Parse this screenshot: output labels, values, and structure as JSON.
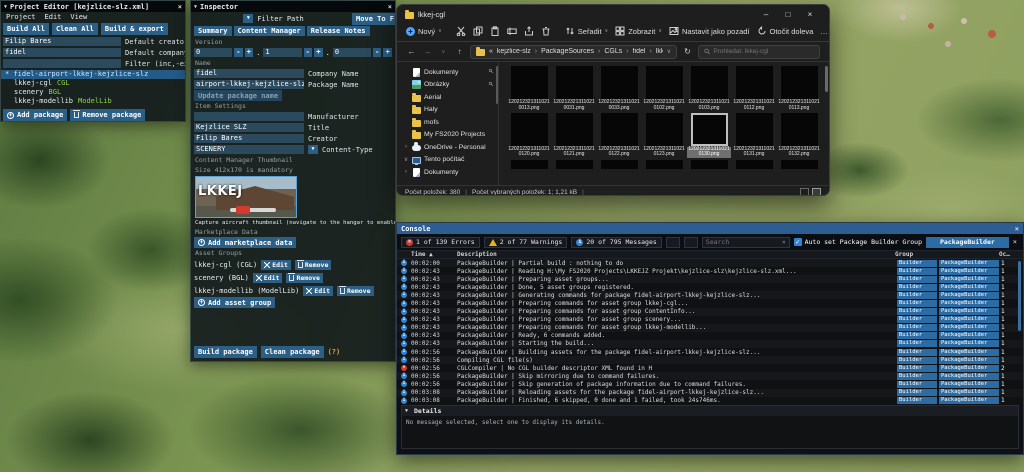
{
  "colors": {
    "accent_blue": "#2d6ca3",
    "sdk_button": "#2c5f86",
    "type_green": "#8ed14f",
    "console_title": "#2d5d91",
    "error_red": "#d23b2e",
    "warning_yellow": "#e7b416",
    "info_blue": "#2f86d6",
    "help_orange": "#e8a13c",
    "folder_yellow": "#e8c24a"
  },
  "icons": {
    "close": "×",
    "minimize": "–",
    "maximize": "□",
    "collapse": "▼",
    "back": "←",
    "forward": "→",
    "up": "↑",
    "refresh": "↻",
    "dropdown": "∨",
    "sort_asc": "▲",
    "check": "✓",
    "more": "…"
  },
  "project_editor": {
    "title": "Project Editor [kejzlice-slz.xml]",
    "menu": [
      "Project",
      "Edit",
      "View"
    ],
    "toolbar": [
      "Build All",
      "Clean All",
      "Build & export"
    ],
    "fields": [
      {
        "value": "Filip Bares",
        "label": "Default creator name"
      },
      {
        "value": "fidel",
        "label": "Default company name"
      },
      {
        "value": "",
        "label": "Filter (inc,-exc)"
      }
    ],
    "tree": {
      "root_prefix": "*",
      "root": "fidel-airport-lkkej-kejzlice-slz",
      "children": [
        {
          "name": "lkkej-cgl",
          "type": "CGL"
        },
        {
          "name": "scenery",
          "type": "BGL"
        },
        {
          "name": "lkkej-modellib",
          "type": "ModelLib"
        }
      ]
    },
    "add_package": "Add package",
    "remove_package": "Remove package"
  },
  "inspector": {
    "title": "Inspector",
    "filter_path": "Filter Path",
    "move_to": "Move To F",
    "tabs": [
      "Summary",
      "Content Manager",
      "Release Notes"
    ],
    "version": {
      "label": "Version",
      "major": "0",
      "minor": "1",
      "patch": "0",
      "minus": "-",
      "plus": "+",
      "dot": "."
    },
    "name_label": "Name",
    "name_fields": [
      {
        "value": "fidel",
        "label": "Company Name"
      },
      {
        "value": "airport-lkkej-kejzlice-slz",
        "label": "Package Name"
      }
    ],
    "update_button": "Update package name",
    "item_label": "Item Settings",
    "item_fields": [
      {
        "value": "",
        "label": "Manufacturer"
      },
      {
        "value": "Kejzlice SLZ",
        "label": "Title"
      },
      {
        "value": "Filip Bares",
        "label": "Creator"
      },
      {
        "value": "SCENERY",
        "label": "Content-Type",
        "kind": "dropdown"
      }
    ],
    "thumb_label": "Content Manager Thumbnail",
    "thumb_note": "Size 412x170 is mandatory",
    "thumb_overlay": "LKKEJ",
    "capture_note": "Capture aircraft thumbnail (navigate to the hangar to enable)",
    "marketplace_label": "Marketplace Data",
    "add_marketplace": "Add marketplace data",
    "asset_groups_label": "Asset Groups",
    "asset_groups": [
      {
        "label": "lkkej-cgl (CGL)"
      },
      {
        "label": "scenery (BGL)"
      },
      {
        "label": "lkkej-modellib (ModelLib)"
      }
    ],
    "edit_label": "Edit",
    "remove_label": "Remove",
    "add_asset_group": "Add asset group",
    "build_package": "Build package",
    "clean_package": "Clean package",
    "help": "(?)"
  },
  "explorer": {
    "title": "lkkej-cgl",
    "toolbar": {
      "new": "Nový",
      "sort": "Seřadit",
      "view": "Zobrazit",
      "wallpaper": "Nastavit jako pozadí",
      "rotate": "Otočit doleva",
      "more": "…"
    },
    "breadcrumb": {
      "prefix": "«",
      "items": [
        "kejzlice-slz",
        "PackageSources",
        "CGLs",
        "fidel",
        "lkkej-cgl"
      ]
    },
    "search_placeholder": "Prohledat: lkkej-cgl",
    "sidebar": [
      {
        "label": "Dokumenty",
        "icon": "doc",
        "pin": "1",
        "chev": ""
      },
      {
        "label": "Obrázky",
        "icon": "pics",
        "pin": "1",
        "chev": ""
      },
      {
        "label": "Aerial",
        "icon": "folder",
        "chev": ""
      },
      {
        "label": "Haly",
        "icon": "folder",
        "chev": ""
      },
      {
        "label": "mofs",
        "icon": "folder",
        "chev": ""
      },
      {
        "label": "My FS2020 Projects",
        "icon": "folder",
        "chev": ""
      },
      {
        "label": "OneDrive - Personal",
        "icon": "cloud",
        "chev": "›"
      },
      {
        "label": "Tento počítač",
        "icon": "pc",
        "chev": "∨"
      },
      {
        "label": "Dokumenty",
        "icon": "doc",
        "chev": "›"
      }
    ],
    "files": {
      "prefix": "120212321311021",
      "items": [
        {
          "name": "0013.png"
        },
        {
          "name": "0031.png"
        },
        {
          "name": "0033.png"
        },
        {
          "name": "0102.png"
        },
        {
          "name": "0103.png"
        },
        {
          "name": "0112.png"
        },
        {
          "name": "0113.png"
        },
        {
          "name": "0120.png"
        },
        {
          "name": "0121.png"
        },
        {
          "name": "0122.png"
        },
        {
          "name": "0123.png"
        },
        {
          "name": "0130.png",
          "sel": "selected"
        },
        {
          "name": "0131.png"
        },
        {
          "name": "0132.png"
        }
      ]
    },
    "status": {
      "items": "Počet položek: 380",
      "selected": "Počet vybraných položek: 1; 1,21 kB"
    }
  },
  "console": {
    "title": "Console",
    "errors": "1 of 139 Errors",
    "warnings": "2 of 77 Warnings",
    "messages": "20 of 795 Messages",
    "search_placeholder": "Search",
    "autoset": "Auto set Package Builder Group",
    "builder_chip": "PackageBuilder",
    "columns": {
      "time": "Time",
      "description": "Description",
      "group": "Group",
      "oc": "Oc…"
    },
    "rows": [
      {
        "lv": "info",
        "t": "00:02:00",
        "d": "PackageBuilder | Partial build : nothing to do",
        "group": "Builder",
        "src": "PackageBuilder",
        "c": "1"
      },
      {
        "lv": "info",
        "t": "00:02:43",
        "d": "PackageBuilder | Reading H:\\My FS2020 Projects\\LKKEJZ Projekt\\kejzlice-slz\\kejzlice-slz.xml...",
        "group": "Builder",
        "src": "PackageBuilder",
        "c": "1"
      },
      {
        "lv": "info",
        "t": "00:02:43",
        "d": "PackageBuilder | Preparing asset groups...",
        "group": "Builder",
        "src": "PackageBuilder",
        "c": "1"
      },
      {
        "lv": "info",
        "t": "00:02:43",
        "d": "PackageBuilder | Done, 5 asset groups registered.",
        "group": "Builder",
        "src": "PackageBuilder",
        "c": "1"
      },
      {
        "lv": "info",
        "t": "00:02:43",
        "d": "PackageBuilder | Generating commands for package fidel-airport-lkkej-kejzlice-slz...",
        "group": "Builder",
        "src": "PackageBuilder",
        "c": "1"
      },
      {
        "lv": "info",
        "t": "00:02:43",
        "d": "PackageBuilder | Preparing commands for asset group lkkej-cgl...",
        "group": "Builder",
        "src": "PackageBuilder",
        "c": "1"
      },
      {
        "lv": "info",
        "t": "00:02:43",
        "d": "PackageBuilder | Preparing commands for asset group ContentInfo...",
        "group": "Builder",
        "src": "PackageBuilder",
        "c": "1"
      },
      {
        "lv": "info",
        "t": "00:02:43",
        "d": "PackageBuilder | Preparing commands for asset group scenery...",
        "group": "Builder",
        "src": "PackageBuilder",
        "c": "1"
      },
      {
        "lv": "info",
        "t": "00:02:43",
        "d": "PackageBuilder | Preparing commands for asset group lkkej-modellib...",
        "group": "Builder",
        "src": "PackageBuilder",
        "c": "1"
      },
      {
        "lv": "info",
        "t": "00:02:43",
        "d": "PackageBuilder | Ready, 6 commands added.",
        "group": "Builder",
        "src": "PackageBuilder",
        "c": "1"
      },
      {
        "lv": "info",
        "t": "00:02:43",
        "d": "PackageBuilder | Starting the build...",
        "group": "Builder",
        "src": "PackageBuilder",
        "c": "1"
      },
      {
        "lv": "info",
        "t": "00:02:56",
        "d": "PackageBuilder | Building assets for the package fidel-airport-lkkej-kejzlice-slz...",
        "group": "Builder",
        "src": "PackageBuilder",
        "c": "1"
      },
      {
        "lv": "info",
        "t": "00:02:56",
        "d": "Compiling CGL file(s)",
        "group": "Builder",
        "src": "PackageBuilder",
        "c": "1"
      },
      {
        "lv": "error",
        "t": "00:02:56",
        "d": "CGLCompiler | No CGL builder descriptor XML found in H",
        "group": "Builder",
        "src": "PackageBuilder",
        "c": "2"
      },
      {
        "lv": "info",
        "t": "00:02:56",
        "d": "PackageBuilder | Skip mirroring due to command failures.",
        "group": "Builder",
        "src": "PackageBuilder",
        "c": "1"
      },
      {
        "lv": "info",
        "t": "00:02:56",
        "d": "PackageBuilder | Skip generation of package information due to command failures.",
        "group": "Builder",
        "src": "PackageBuilder",
        "c": "1"
      },
      {
        "lv": "info",
        "t": "00:03:08",
        "d": "PackageBuilder | Reloading assets for the package fidel-airport-lkkej-kejzlice-slz...",
        "group": "Builder",
        "src": "PackageBuilder",
        "c": "1"
      },
      {
        "lv": "info",
        "t": "00:03:08",
        "d": "PackageBuilder | Finished, 6 skipped, 0 done and 1 failed, took 24s746ms.",
        "group": "Builder",
        "src": "PackageBuilder",
        "c": "1"
      }
    ],
    "details": {
      "label": "Details",
      "body": "No message selected, select one to display its details."
    }
  }
}
